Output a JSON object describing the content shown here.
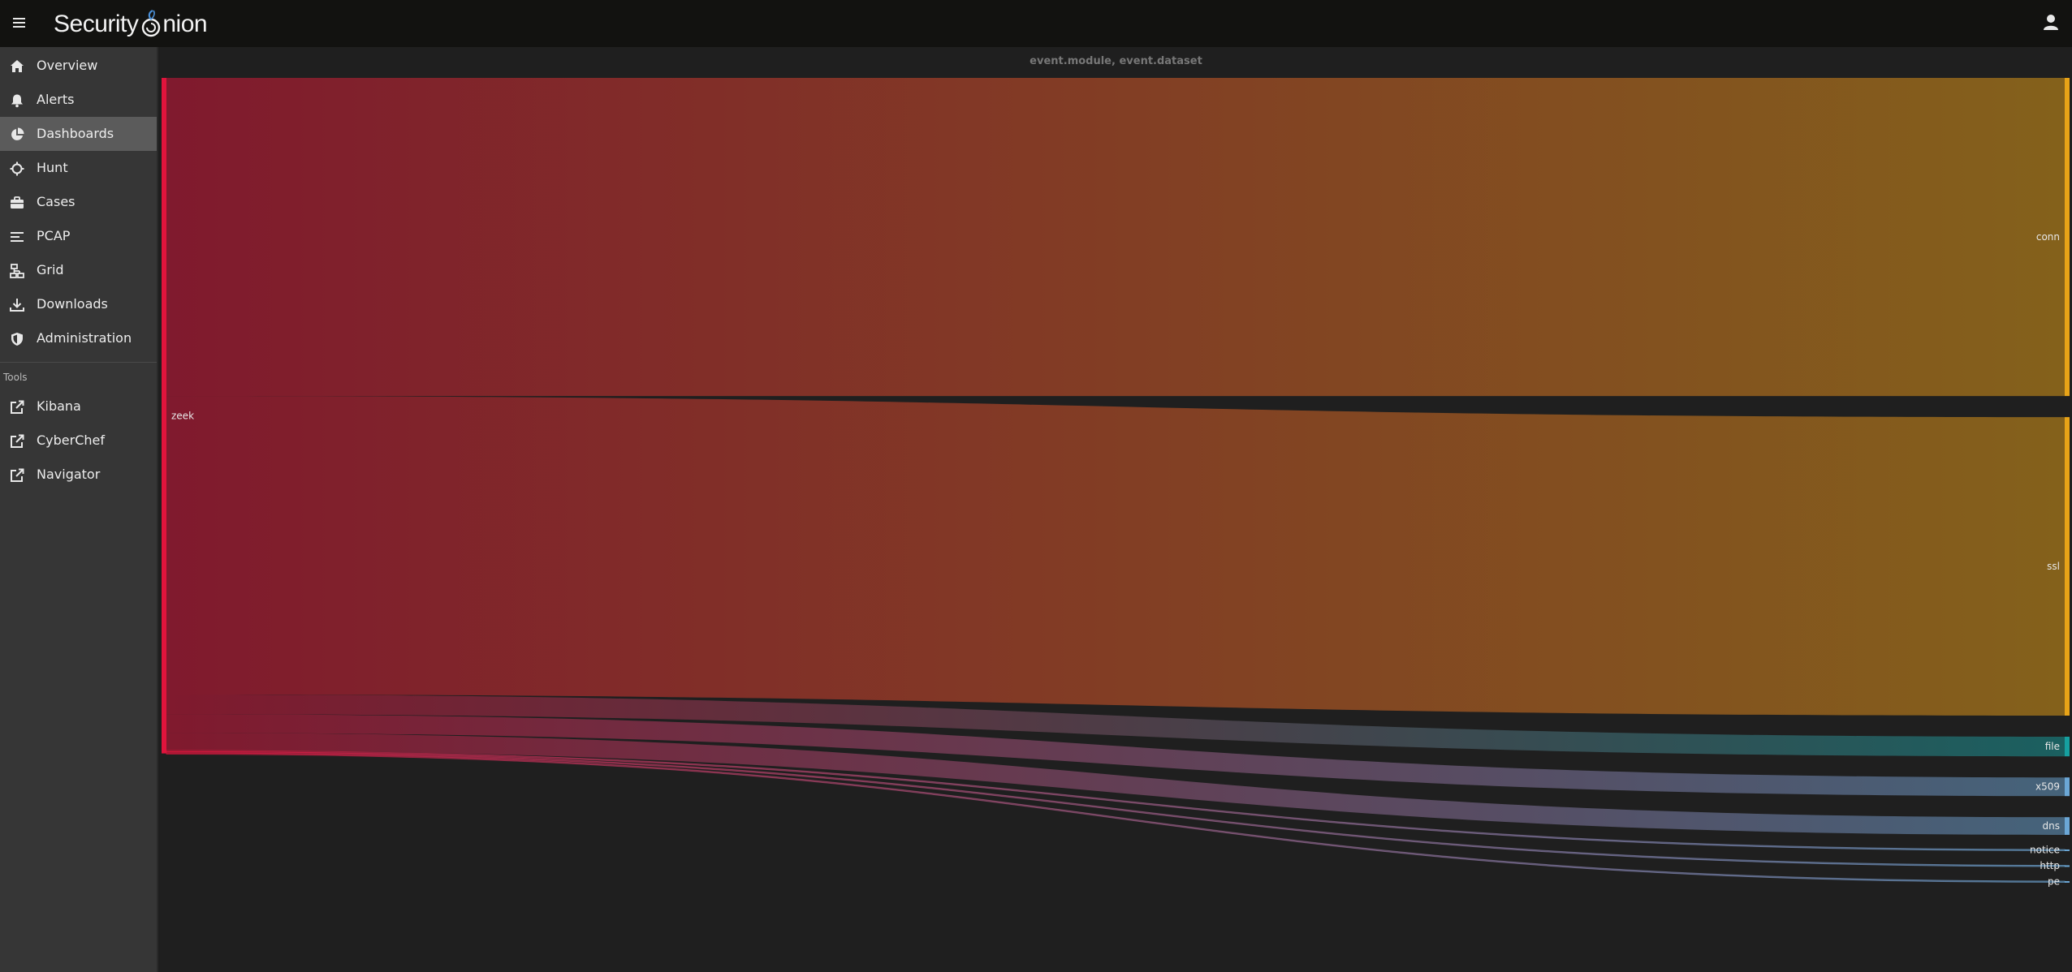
{
  "app": {
    "brand_left": "Security",
    "brand_right": "nion"
  },
  "sidebar": {
    "items": [
      {
        "label": "Overview",
        "icon": "home-icon",
        "active": false
      },
      {
        "label": "Alerts",
        "icon": "bell-icon",
        "active": false
      },
      {
        "label": "Dashboards",
        "icon": "pie-chart-icon",
        "active": true
      },
      {
        "label": "Hunt",
        "icon": "crosshairs-icon",
        "active": false
      },
      {
        "label": "Cases",
        "icon": "briefcase-icon",
        "active": false
      },
      {
        "label": "PCAP",
        "icon": "list-icon",
        "active": false
      },
      {
        "label": "Grid",
        "icon": "sitemap-icon",
        "active": false
      },
      {
        "label": "Downloads",
        "icon": "download-icon",
        "active": false
      },
      {
        "label": "Administration",
        "icon": "shield-icon",
        "active": false
      }
    ],
    "tools_header": "Tools",
    "tools": [
      {
        "label": "Kibana",
        "icon": "external-link-icon"
      },
      {
        "label": "CyberChef",
        "icon": "external-link-icon"
      },
      {
        "label": "Navigator",
        "icon": "external-link-icon"
      }
    ]
  },
  "chart_data": {
    "type": "sankey",
    "title": "event.module, event.dataset",
    "source_nodes": [
      {
        "name": "zeek",
        "color": "#e0143c"
      }
    ],
    "target_nodes": [
      {
        "name": "conn",
        "color": "#e8a317"
      },
      {
        "name": "ssl",
        "color": "#e8a317"
      },
      {
        "name": "file",
        "color": "#16a0a0"
      },
      {
        "name": "x509",
        "color": "#6ba7d6"
      },
      {
        "name": "dns",
        "color": "#6ba7d6"
      },
      {
        "name": "notice",
        "color": "#6ba7d6"
      },
      {
        "name": "http",
        "color": "#6ba7d6"
      },
      {
        "name": "pe",
        "color": "#6ba7d6"
      }
    ],
    "links": [
      {
        "source": "zeek",
        "target": "conn",
        "value": 16200
      },
      {
        "source": "zeek",
        "target": "ssl",
        "value": 15200
      },
      {
        "source": "zeek",
        "target": "file",
        "value": 1000
      },
      {
        "source": "zeek",
        "target": "x509",
        "value": 950
      },
      {
        "source": "zeek",
        "target": "dns",
        "value": 900
      },
      {
        "source": "zeek",
        "target": "notice",
        "value": 60
      },
      {
        "source": "zeek",
        "target": "http",
        "value": 50
      },
      {
        "source": "zeek",
        "target": "pe",
        "value": 40
      }
    ]
  }
}
